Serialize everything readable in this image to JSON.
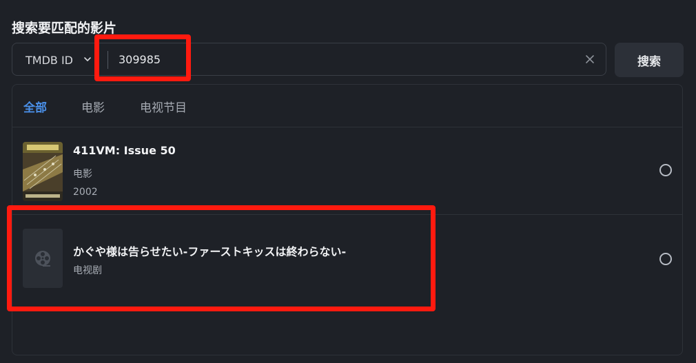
{
  "section": {
    "title": "搜索要匹配的影片"
  },
  "search": {
    "type_selected": "TMDB ID",
    "query_value": "309985",
    "button_label": "搜索"
  },
  "tabs": [
    {
      "label": "全部",
      "active": true
    },
    {
      "label": "电影",
      "active": false
    },
    {
      "label": "电视节目",
      "active": false
    }
  ],
  "results": [
    {
      "title": "411VM: Issue 50",
      "type": "电影",
      "year": "2002",
      "poster_icon": "magazine-cover-image"
    },
    {
      "title": "かぐや様は告らせたい-ファーストキッスは終わらない-",
      "type": "电视剧",
      "poster_icon": "film-reel-icon"
    }
  ],
  "colors": {
    "background": "#1e2127",
    "accent": "#4a8fe7",
    "highlight": "#ff1a0f"
  }
}
